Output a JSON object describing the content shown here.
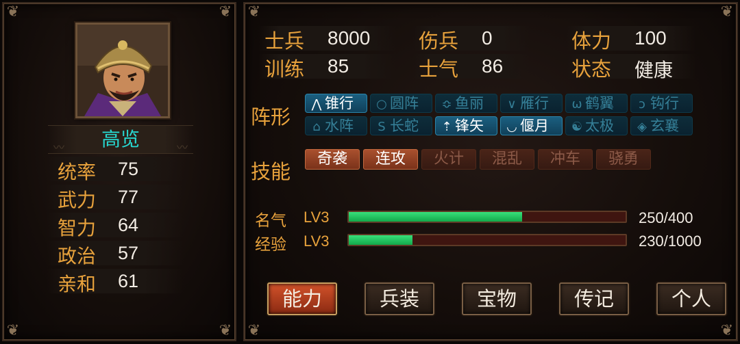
{
  "general": {
    "name": "高览",
    "attributes": [
      {
        "label": "统率",
        "value": "75"
      },
      {
        "label": "武力",
        "value": "77"
      },
      {
        "label": "智力",
        "value": "64"
      },
      {
        "label": "政治",
        "value": "57"
      },
      {
        "label": "亲和",
        "value": "61"
      }
    ]
  },
  "stats": {
    "soldiers": {
      "label": "士兵",
      "value": "8000"
    },
    "wounded": {
      "label": "伤兵",
      "value": "0"
    },
    "stamina": {
      "label": "体力",
      "value": "100"
    },
    "training": {
      "label": "训练",
      "value": "85"
    },
    "morale": {
      "label": "士气",
      "value": "86"
    },
    "status": {
      "label": "状态",
      "value": "健康"
    }
  },
  "formations": {
    "label": "阵形",
    "items": [
      {
        "name": "锥行",
        "icon": "arrow-up-icon",
        "glyph": "⋀",
        "active": true
      },
      {
        "name": "圆阵",
        "icon": "circle-icon",
        "glyph": "○",
        "active": false
      },
      {
        "name": "鱼丽",
        "icon": "fish-icon",
        "glyph": "≎",
        "active": false
      },
      {
        "name": "雁行",
        "icon": "v-shape-icon",
        "glyph": "∨",
        "active": false
      },
      {
        "name": "鹤翼",
        "icon": "wings-icon",
        "glyph": "ω",
        "active": false
      },
      {
        "name": "钩行",
        "icon": "hook-icon",
        "glyph": "ↄ",
        "active": false
      },
      {
        "name": "水阵",
        "icon": "wave-icon",
        "glyph": "⌂",
        "active": false
      },
      {
        "name": "长蛇",
        "icon": "snake-icon",
        "glyph": "S",
        "active": false
      },
      {
        "name": "锋矢",
        "icon": "arrowhead-icon",
        "glyph": "⇡",
        "active": true
      },
      {
        "name": "偃月",
        "icon": "crescent-icon",
        "glyph": "◡",
        "active": true
      },
      {
        "name": "太极",
        "icon": "taiji-icon",
        "glyph": "☯",
        "active": false
      },
      {
        "name": "玄襄",
        "icon": "diamond-icon",
        "glyph": "◈",
        "active": false
      }
    ]
  },
  "skills": {
    "label": "技能",
    "items": [
      {
        "name": "奇袭",
        "active": true
      },
      {
        "name": "连攻",
        "active": true
      },
      {
        "name": "火计",
        "active": false
      },
      {
        "name": "混乱",
        "active": false
      },
      {
        "name": "冲车",
        "active": false
      },
      {
        "name": "骁勇",
        "active": false
      }
    ]
  },
  "progress": {
    "fame": {
      "label": "名气",
      "level": "LV3",
      "value_text": "250/400",
      "fraction": 0.625
    },
    "exp": {
      "label": "经验",
      "level": "LV3",
      "value_text": "230/1000",
      "fraction": 0.23
    }
  },
  "tabs": [
    {
      "label": "能力",
      "active": true
    },
    {
      "label": "兵装",
      "active": false
    },
    {
      "label": "宝物",
      "active": false
    },
    {
      "label": "传记",
      "active": false
    },
    {
      "label": "个人",
      "active": false
    }
  ],
  "colors": {
    "accent_label": "#e8a23c",
    "name": "#27d7d0",
    "bar_fill": "#22c35f",
    "tab_active": "#c0461f"
  }
}
